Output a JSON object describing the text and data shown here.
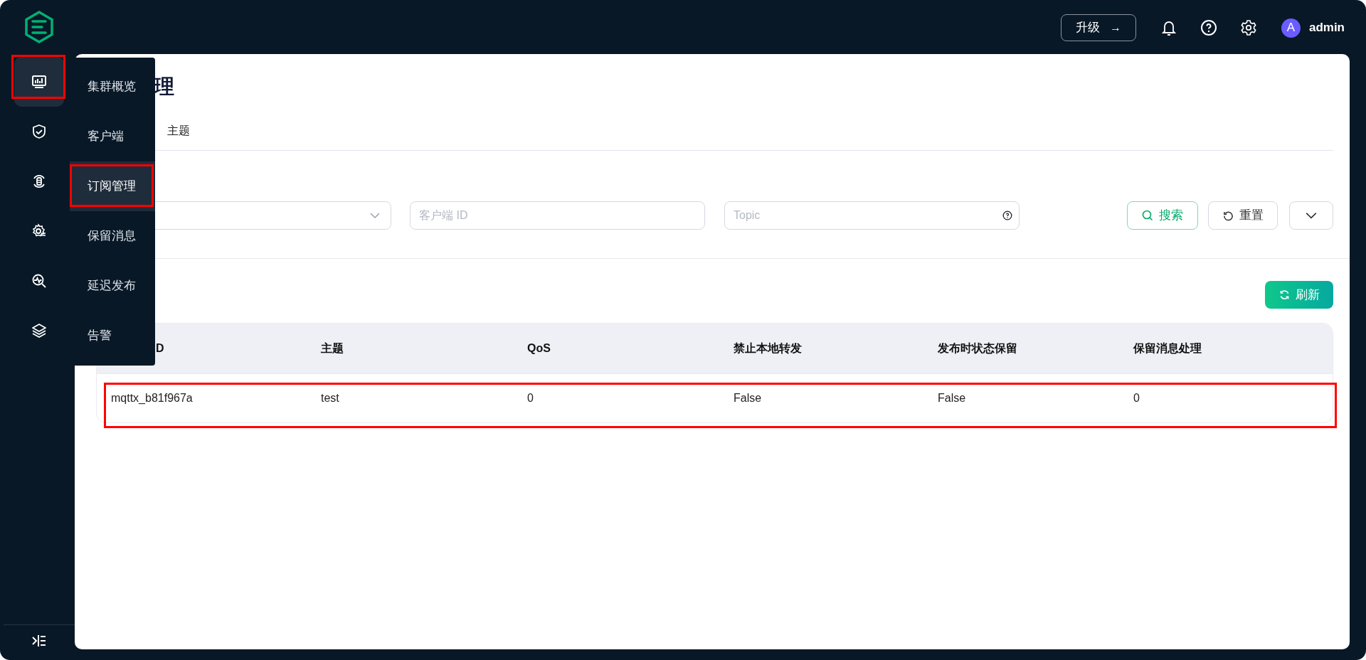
{
  "header": {
    "upgrade_button": "升级",
    "upgrade_arrow": "→",
    "user": {
      "avatar": "A",
      "name": "admin"
    }
  },
  "sidebar": {
    "items": [
      {
        "kind": "dashboard",
        "selected": true,
        "highlighted": true
      },
      {
        "kind": "shield",
        "selected": false,
        "highlighted": false
      },
      {
        "kind": "integration",
        "selected": false,
        "highlighted": false
      },
      {
        "kind": "settings",
        "selected": false,
        "highlighted": false
      },
      {
        "kind": "diagnose",
        "selected": false,
        "highlighted": false
      },
      {
        "kind": "layers",
        "selected": false,
        "highlighted": false
      }
    ]
  },
  "flyout_menu": {
    "items": [
      {
        "label": "集群概览",
        "selected": false,
        "highlighted": false
      },
      {
        "label": "客户端",
        "selected": false,
        "highlighted": false
      },
      {
        "label": "订阅管理",
        "selected": true,
        "highlighted": true
      },
      {
        "label": "保留消息",
        "selected": false,
        "highlighted": false
      },
      {
        "label": "延迟发布",
        "selected": false,
        "highlighted": false
      },
      {
        "label": "告警",
        "selected": false,
        "highlighted": false
      }
    ]
  },
  "page": {
    "title": "理",
    "tabs": [
      "主题"
    ]
  },
  "filters": {
    "client_id": {
      "placeholder": "客户端 ID"
    },
    "topic": {
      "placeholder": "Topic"
    },
    "search_button": "搜索",
    "reset_button": "重置"
  },
  "refresh_button": "刷新",
  "table": {
    "columns": [
      "D",
      "主题",
      "QoS",
      "禁止本地转发",
      "发布时状态保留",
      "保留消息处理"
    ],
    "rows": [
      {
        "cells": [
          "mqttx_b81f967a",
          "test",
          "0",
          "False",
          "False",
          "0"
        ],
        "highlighted": true
      }
    ]
  }
}
